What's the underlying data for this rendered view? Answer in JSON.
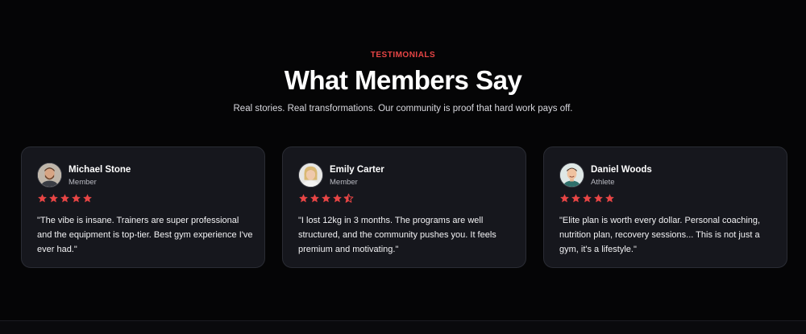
{
  "section": {
    "eyebrow": "TESTIMONIALS",
    "title": "What Members Say",
    "subtitle": "Real stories. Real transformations. Our community is proof that hard work pays off."
  },
  "colors": {
    "accent": "#e84545",
    "background": "#050506",
    "card": "#16171d",
    "card_border": "#2a2c34"
  },
  "testimonials": [
    {
      "name": "Michael Stone",
      "role": "Member",
      "rating": 5,
      "quote": "\"The vibe is insane. Trainers are super professional and the equipment is top-tier. Best gym experience I've ever had.\"",
      "avatar_icon": "avatar-man-beard-icon"
    },
    {
      "name": "Emily Carter",
      "role": "Member",
      "rating": 4.5,
      "quote": "\"I lost 12kg in 3 months. The programs are well structured, and the community pushes you. It feels premium and motivating.\"",
      "avatar_icon": "avatar-woman-blonde-icon"
    },
    {
      "name": "Daniel Woods",
      "role": "Athlete",
      "rating": 5,
      "quote": "\"Elite plan is worth every dollar. Personal coaching, nutrition plan, recovery sessions... This is not just a gym, it's a lifestyle.\"",
      "avatar_icon": "avatar-man-smiling-icon"
    }
  ]
}
